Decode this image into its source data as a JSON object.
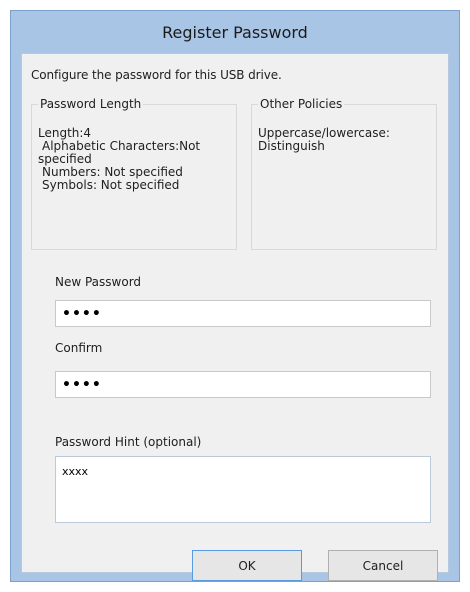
{
  "dialog": {
    "title": "Register Password",
    "intro": "Configure the password for this USB drive.",
    "password_length_group": {
      "title": "Password Length",
      "lines": [
        "Length:4",
        "Alphabetic Characters:Not",
        "specified",
        "Numbers: Not specified",
        "Symbols: Not specified"
      ]
    },
    "other_policies_group": {
      "title": "Other Policies",
      "lines": [
        "Uppercase/lowercase:",
        "Distinguish"
      ]
    },
    "new_password": {
      "label": "New Password",
      "value": "••••"
    },
    "confirm": {
      "label": "Confirm",
      "value": "••••"
    },
    "hint": {
      "label": "Password Hint (optional)",
      "value": "xxxx"
    },
    "buttons": {
      "ok": "OK",
      "cancel": "Cancel"
    }
  }
}
